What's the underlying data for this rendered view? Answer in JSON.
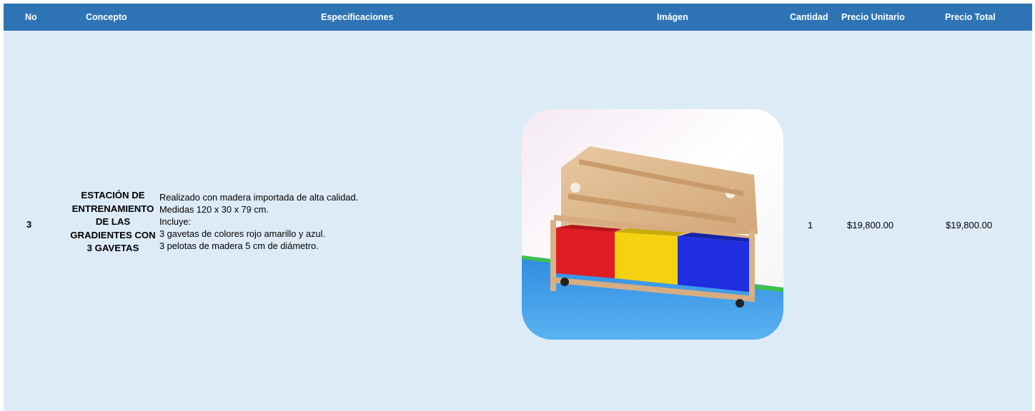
{
  "header": {
    "no": "No",
    "concepto": "Concepto",
    "especificaciones": "Especificaciones",
    "imagen": "Imágen",
    "cantidad": "Cantidad",
    "precio_unitario": "Precio Unitario",
    "precio_total": "Precio Total"
  },
  "row": {
    "no": "3",
    "concepto": "ESTACIÓN DE ENTRENAMIENTO DE LAS GRADIENTES CON 3 GAVETAS",
    "especificaciones": "Realizado con madera importada de alta calidad.\nMedidas 120 x 30 x 79 cm.\nIncluye:\n3 gavetas de colores rojo amarillo y azul.\n3 pelotas de madera 5 cm de diámetro.",
    "cantidad": "1",
    "precio_unitario": "$19,800.00",
    "precio_total": "$19,800.00"
  },
  "colors": {
    "header_bg": "#2e74b5",
    "row_bg": "#ddebf7"
  }
}
